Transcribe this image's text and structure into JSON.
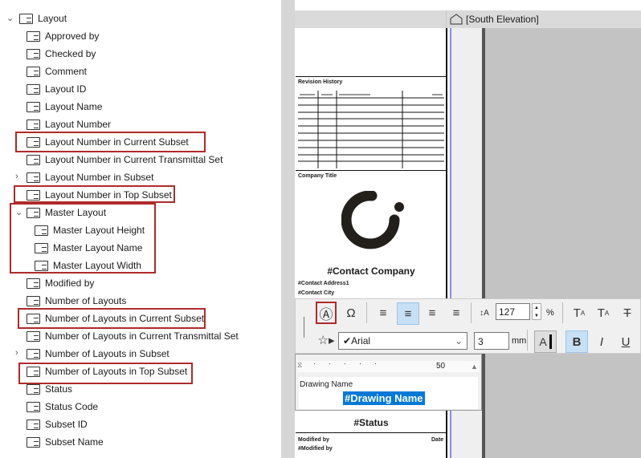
{
  "tree": {
    "root": "Layout",
    "items": [
      "Approved by",
      "Checked by",
      "Comment",
      "Layout ID",
      "Layout Name",
      "Layout Number",
      "Layout Number in Current Subset",
      "Layout Number in Current Transmittal Set",
      "Layout Number in Subset",
      "Layout Number in Top Subset",
      "Master Layout",
      "Master Layout Height",
      "Master Layout Name",
      "Master Layout Width",
      "Modified by",
      "Number of Layouts",
      "Number of Layouts in Current Subset",
      "Number of Layouts in Current Transmittal Set",
      "Number of Layouts in Subset",
      "Number of Layouts in Top Subset",
      "Status",
      "Status Code",
      "Subset ID",
      "Subset Name"
    ]
  },
  "view": {
    "tab": "[South Elevation]"
  },
  "sheet": {
    "revision_history": "Revision History",
    "company_title": "Company Title",
    "contact_company": "#Contact Company",
    "contact_address": "#Contact Address1",
    "contact_city": "#Contact City",
    "status": "#Status",
    "modified_by_label": "Modified by",
    "date_label": "Date",
    "modified_by_value": "#Modified by"
  },
  "toolbar": {
    "line_spacing": "127",
    "percent": "%",
    "font": "Arial",
    "size": "3",
    "unit": "mm",
    "bold": "B",
    "italic": "I",
    "underline": "U"
  },
  "editor": {
    "ruler_mark": "50",
    "label": "Drawing Name",
    "value": "#Drawing Name"
  },
  "colors": {
    "highlight": "#b02a2a",
    "selection": "#0078d7"
  }
}
